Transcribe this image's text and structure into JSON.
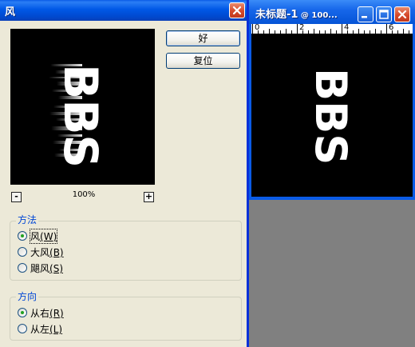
{
  "dialog": {
    "title": "风",
    "ok_label": "好",
    "reset_label": "复位",
    "zoom_minus": "-",
    "zoom_plus": "+",
    "zoom_level": "100%",
    "preview_text": "BBS",
    "method": {
      "title": "方法",
      "options": [
        {
          "label": "风",
          "hotkey": "(W)",
          "checked": true
        },
        {
          "label": "大风",
          "hotkey": "(B)",
          "checked": false
        },
        {
          "label": "飓风",
          "hotkey": "(S)",
          "checked": false
        }
      ]
    },
    "direction": {
      "title": "方向",
      "options": [
        {
          "label": "从右",
          "hotkey": "(R)",
          "checked": true
        },
        {
          "label": "从左",
          "hotkey": "(L)",
          "checked": false
        }
      ]
    }
  },
  "document": {
    "title": "未标题-1",
    "zoom": " @ 100...",
    "canvas_text": "BBS",
    "ruler_labels": [
      "0",
      "2",
      "4",
      "6"
    ]
  },
  "colors": {
    "titlebar": "#0058E6",
    "dialog_bg": "#ECE9D8",
    "group_title": "#0046D5",
    "radio_dot": "#21A121",
    "close_red": "#D5482A",
    "workspace": "#808080"
  }
}
